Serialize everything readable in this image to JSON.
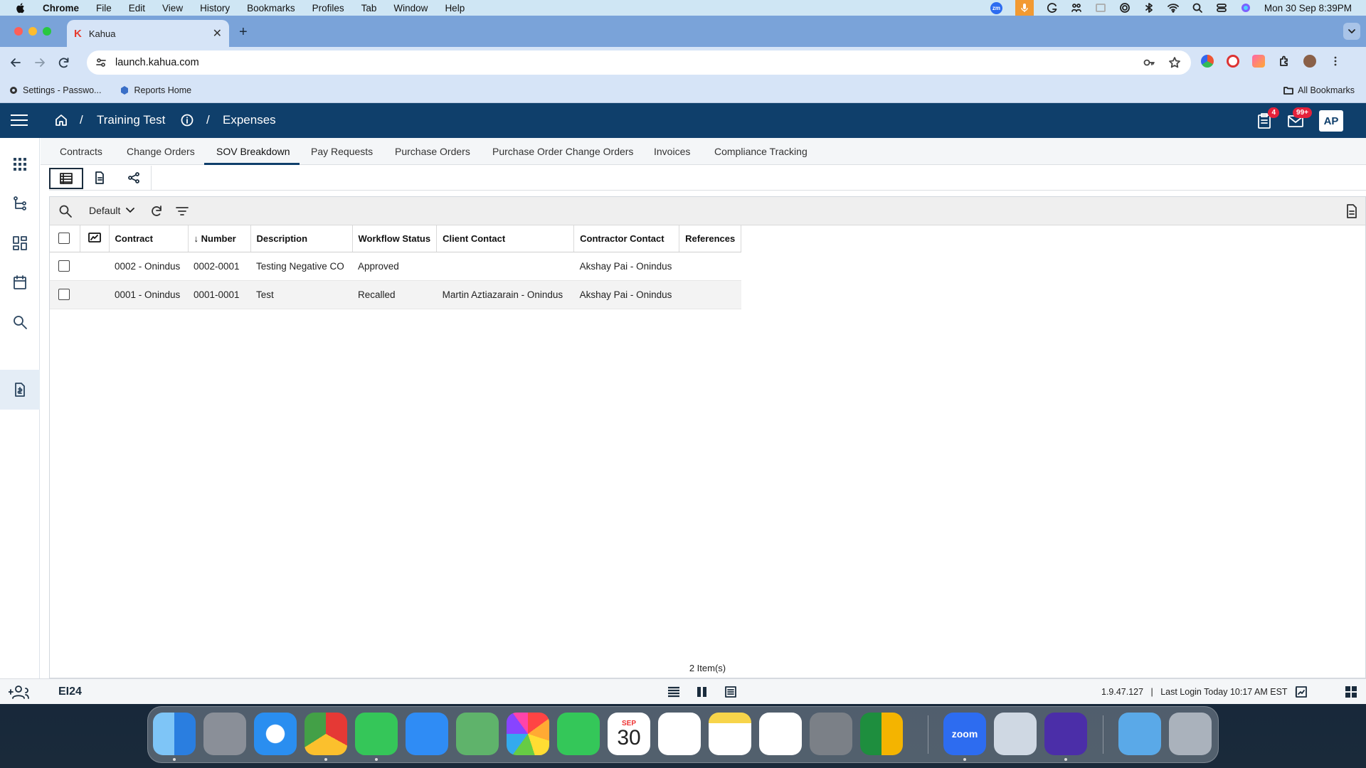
{
  "menubar": {
    "app_name": "Chrome",
    "items": [
      "File",
      "Edit",
      "View",
      "History",
      "Bookmarks",
      "Profiles",
      "Tab",
      "Window",
      "Help"
    ],
    "zoom_badge": "zm",
    "clock": "Mon 30 Sep  8:39PM"
  },
  "browser": {
    "tab_title": "Kahua",
    "tab_favicon": "K",
    "url": "launch.kahua.com",
    "bookmarks": [
      "Settings - Passwo...",
      "Reports Home"
    ],
    "all_bookmarks": "All Bookmarks"
  },
  "header": {
    "project": "Training Test",
    "module": "Expenses",
    "separator": "/",
    "tasks_badge": "4",
    "messages_badge": "99+",
    "avatar_initials": "AP"
  },
  "tabs": [
    {
      "label": "Contracts"
    },
    {
      "label": "Change Orders"
    },
    {
      "label": "SOV Breakdown"
    },
    {
      "label": "Pay Requests"
    },
    {
      "label": "Purchase Orders"
    },
    {
      "label": "Purchase Order Change Orders"
    },
    {
      "label": "Invoices"
    },
    {
      "label": "Compliance Tracking"
    }
  ],
  "active_tab": "SOV Breakdown",
  "grid": {
    "view_name": "Default",
    "columns": [
      "Contract",
      "Number",
      "Description",
      "Workflow Status",
      "Client Contact",
      "Contractor Contact",
      "References"
    ],
    "sort_column": "Number",
    "rows": [
      {
        "contract": "0002 - Onindus",
        "number": "0002-0001",
        "description": "Testing Negative CO",
        "status": "Approved",
        "client": "",
        "contractor": "Akshay Pai - Onindus",
        "references": ""
      },
      {
        "contract": "0001 - Onindus",
        "number": "0001-0001",
        "description": "Test",
        "status": "Recalled",
        "client": "Martin Aztiazarain - Onindus",
        "contractor": "Akshay Pai - Onindus",
        "references": ""
      }
    ],
    "item_count": "2  Item(s)"
  },
  "footer": {
    "env_logo": "EI24",
    "version": "1.9.47.127",
    "last_login": "Last Login Today 10:17 AM EST",
    "divider": "|"
  },
  "dock": {
    "calendar_month": "SEP",
    "calendar_day": "30",
    "zoom_label": "zoom"
  },
  "colors": {
    "header_bg": "#0f3f6b",
    "badge_red": "#e5213a",
    "menubar_bg": "#cfe6f4",
    "tabstrip_bg": "#7aa3d9",
    "toolbar_bg": "#d6e4f7"
  }
}
